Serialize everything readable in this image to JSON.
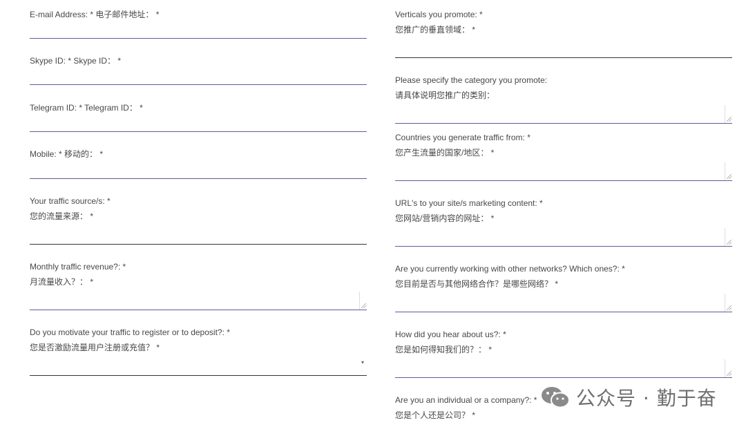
{
  "left_fields": [
    {
      "label": "E-mail Address: *  电子邮件地址： *"
    },
    {
      "label": "Skype ID: *  Skype ID： *"
    },
    {
      "label": "Telegram ID: *  Telegram ID： *"
    },
    {
      "label": "Mobile: *  移动的：  *"
    },
    {
      "label": "Your traffic source/s: *",
      "label_cn": "您的流量来源： *"
    },
    {
      "label": "Monthly traffic revenue?: *",
      "label_cn": "月流量收入？： *"
    },
    {
      "label": "Do you motivate your traffic to register or to deposit?: *",
      "label_cn": "您是否激励流量用户注册或充值？ *"
    }
  ],
  "right_fields": [
    {
      "label": "Verticals you promote: *",
      "label_cn": "您推广的垂直领域： *"
    },
    {
      "label": "Please specify the category you promote:",
      "label_cn": "请具体说明您推广的类别："
    },
    {
      "label": "Countries you generate traffic from: *",
      "label_cn": "您产生流量的国家/地区： *"
    },
    {
      "label": "URL's to your site/s marketing content: *",
      "label_cn": "您网站/营销内容的网址： *"
    },
    {
      "label": "Are you currently working with other networks? Which ones?: *",
      "label_cn": "您目前是否与其他网络合作？是哪些网络？ *"
    },
    {
      "label": "How did you hear about us?: *",
      "label_cn": "您是如何得知我们的？： *"
    },
    {
      "label": "Are you an individual or a company?: *",
      "label_cn": "您是个人还是公司？ *"
    }
  ],
  "select_caret": "▾",
  "watermark": {
    "text": "公众号 · 勤于奋"
  }
}
